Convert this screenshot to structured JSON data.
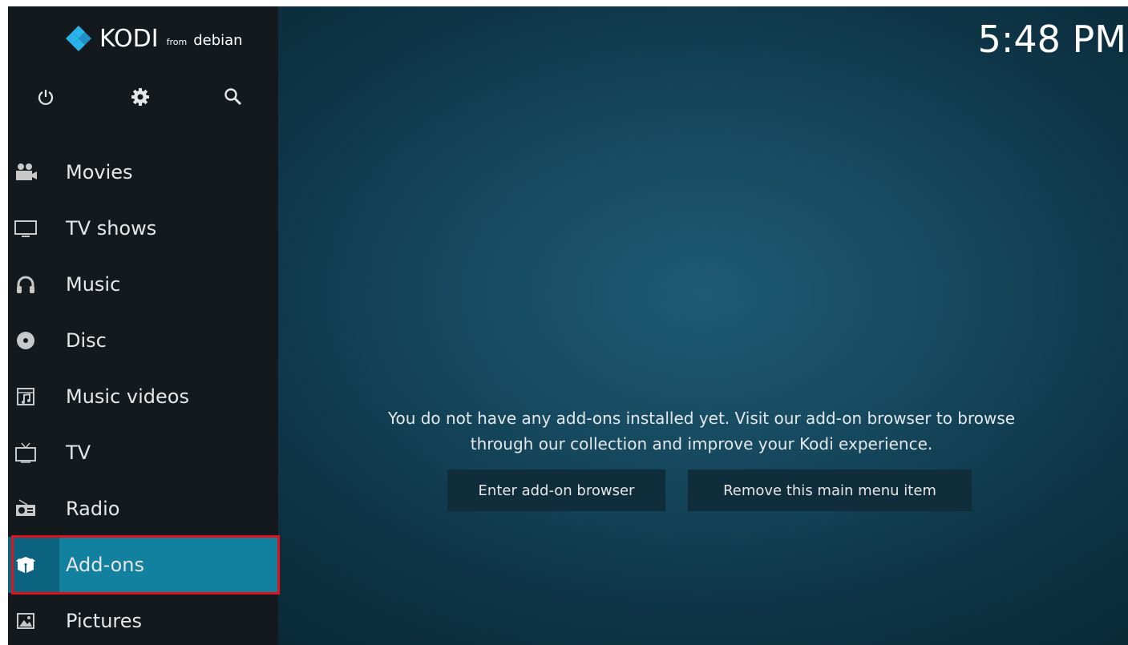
{
  "logo": {
    "name": "KODI",
    "from": "from",
    "distro": "debian"
  },
  "top_icons": [
    "power-icon",
    "settings-icon",
    "search-icon"
  ],
  "clock": "5:48 PM",
  "menu": {
    "items": [
      {
        "label": "Movies",
        "icon": "movies-icon"
      },
      {
        "label": "TV shows",
        "icon": "tv-shows-icon"
      },
      {
        "label": "Music",
        "icon": "music-icon"
      },
      {
        "label": "Disc",
        "icon": "disc-icon"
      },
      {
        "label": "Music videos",
        "icon": "music-videos-icon"
      },
      {
        "label": "TV",
        "icon": "tv-icon"
      },
      {
        "label": "Radio",
        "icon": "radio-icon"
      },
      {
        "label": "Add-ons",
        "icon": "addons-icon",
        "selected": true
      },
      {
        "label": "Pictures",
        "icon": "pictures-icon"
      }
    ]
  },
  "main": {
    "message_line1": "You do not have any add-ons installed yet. Visit our add-on browser to browse",
    "message_line2": "through our collection and improve your Kodi experience.",
    "button_browser": "Enter add-on browser",
    "button_remove": "Remove this main menu item"
  },
  "colors": {
    "accent": "#12809f",
    "highlight_border": "#e0121b",
    "sidebar_bg": "#14191d"
  }
}
